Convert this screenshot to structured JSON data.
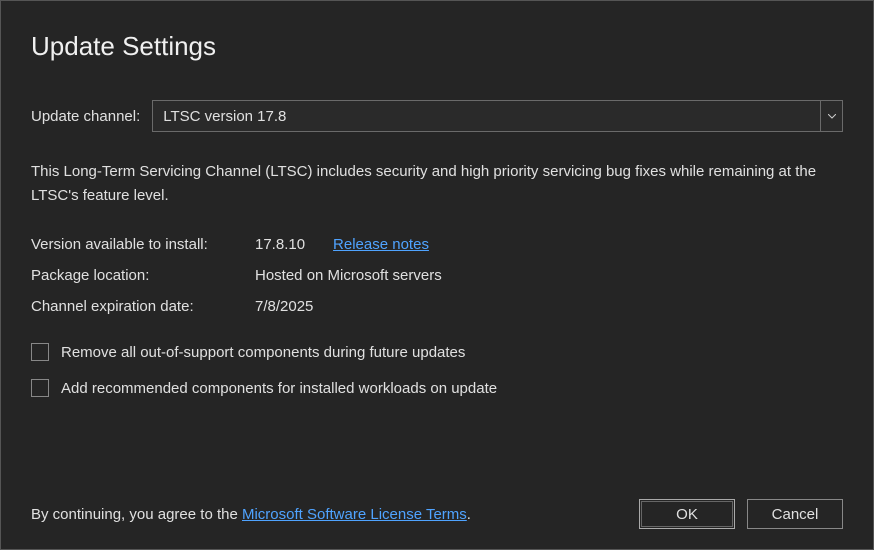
{
  "title": "Update Settings",
  "channel": {
    "label": "Update channel:",
    "selected": "LTSC version 17.8"
  },
  "description": "This Long-Term Servicing Channel (LTSC) includes security and high priority servicing bug fixes while remaining at the LTSC's feature level.",
  "info": {
    "version_label": "Version available to install:",
    "version_value": "17.8.10",
    "release_notes": "Release notes",
    "package_label": "Package location:",
    "package_value": "Hosted on Microsoft servers",
    "expiration_label": "Channel expiration date:",
    "expiration_value": "7/8/2025"
  },
  "checkboxes": {
    "remove_unsupported": "Remove all out-of-support components during future updates",
    "add_recommended": "Add recommended components for installed workloads on update"
  },
  "footer": {
    "agree_prefix": "By continuing, you agree to the ",
    "license_link": "Microsoft Software License Terms",
    "agree_suffix": ".",
    "ok": "OK",
    "cancel": "Cancel"
  }
}
